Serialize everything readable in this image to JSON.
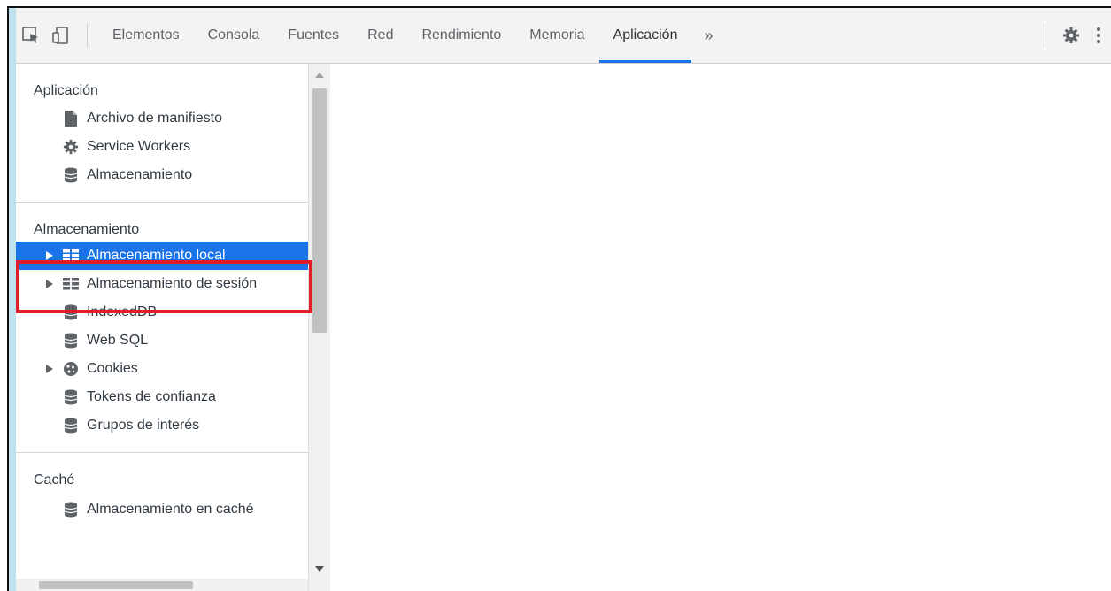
{
  "toolbar": {
    "tabs": [
      {
        "label": "Elementos"
      },
      {
        "label": "Consola"
      },
      {
        "label": "Fuentes"
      },
      {
        "label": "Red"
      },
      {
        "label": "Rendimiento"
      },
      {
        "label": "Memoria"
      },
      {
        "label": "Aplicación",
        "active": true
      }
    ],
    "more_label": "»",
    "icons": [
      "inspect-element-icon",
      "device-toggle-icon",
      "gear-icon",
      "kebab-menu-icon"
    ]
  },
  "sidebar": {
    "sections": [
      {
        "title": "Aplicación",
        "items": [
          {
            "label": "Archivo de manifiesto",
            "icon": "file-icon"
          },
          {
            "label": "Service Workers",
            "icon": "gear-icon"
          },
          {
            "label": "Almacenamiento",
            "icon": "database-icon"
          }
        ]
      },
      {
        "title": "Almacenamiento",
        "items": [
          {
            "label": "Almacenamiento local",
            "icon": "grid-icon",
            "expandable": true,
            "selected": true
          },
          {
            "label": "Almacenamiento de sesión",
            "icon": "grid-icon",
            "expandable": true
          },
          {
            "label": "IndexedDB",
            "icon": "database-icon"
          },
          {
            "label": "Web SQL",
            "icon": "database-icon"
          },
          {
            "label": "Cookies",
            "icon": "cookie-icon",
            "expandable": true
          },
          {
            "label": "Tokens de confianza",
            "icon": "database-icon"
          },
          {
            "label": "Grupos de interés",
            "icon": "database-icon"
          }
        ]
      },
      {
        "title": "Caché",
        "items": [
          {
            "label": "Almacenamiento en caché",
            "icon": "database-icon"
          }
        ]
      }
    ]
  },
  "colors": {
    "accent": "#1a73e8",
    "highlight": "#e11d2a",
    "left_strip": "#bfe2ef"
  }
}
